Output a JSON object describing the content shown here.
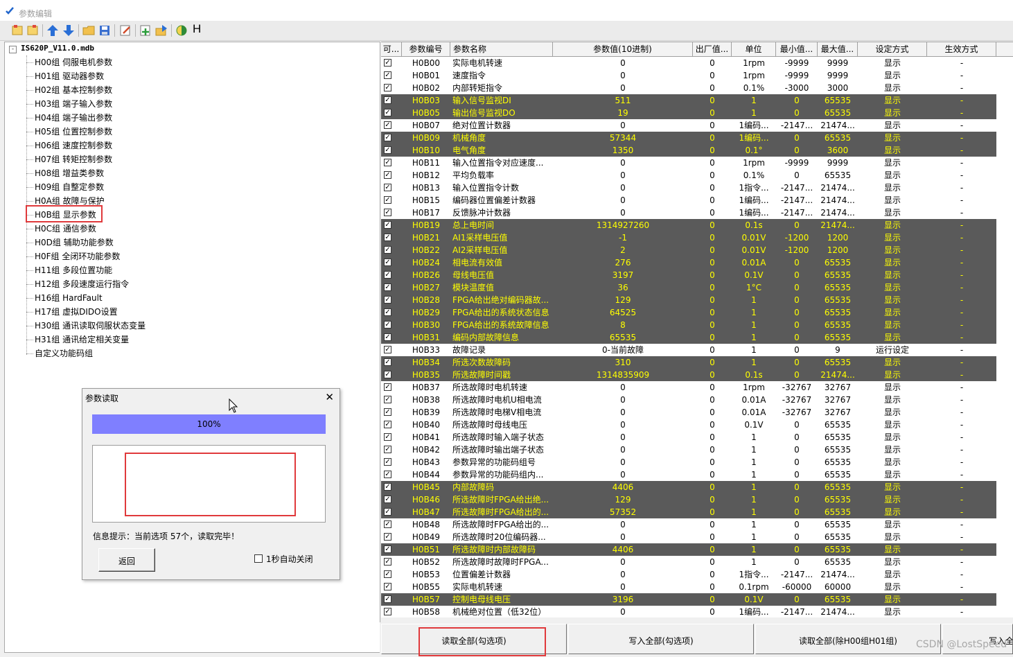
{
  "window": {
    "title": "参数编辑"
  },
  "toolbar": {
    "icons": [
      "new-icon",
      "new-folder-icon",
      "arrow-up-icon",
      "arrow-down-icon",
      "open-folder-icon",
      "save-icon",
      "edit-doc-icon",
      "add-icon",
      "import-icon",
      "contrast-icon"
    ],
    "h_label": "H"
  },
  "tree": {
    "root": "IS620P_V11.0.mdb",
    "expander": "-",
    "items": [
      "H00组 伺服电机参数",
      "H01组 驱动器参数",
      "H02组 基本控制参数",
      "H03组 端子输入参数",
      "H04组 端子输出参数",
      "H05组 位置控制参数",
      "H06组 速度控制参数",
      "H07组 转矩控制参数",
      "H08组 增益类参数",
      "H09组 自整定参数",
      "H0A组 故障与保护",
      "H0B组 显示参数",
      "H0C组 通信参数",
      "H0D组 辅助功能参数",
      "H0F组 全闭环功能参数",
      "H11组 多段位置功能",
      "H12组 多段速度运行指令",
      "H16组 HardFault",
      "H17组 虚拟DIDO设置",
      "H30组 通讯读取伺服状态变量",
      "H31组 通讯给定相关变量",
      "自定义功能码组"
    ]
  },
  "dialog": {
    "title": "参数读取",
    "close": "✕",
    "progress_percent": 100,
    "progress_label": "100%",
    "message_text": "",
    "info": "信息提示：当前选项 57个，读取完毕！",
    "back_button": "返回",
    "auto_close_label": "1秒自动关闭",
    "auto_close_checked": false
  },
  "table": {
    "columns": [
      "可...",
      "参数编号",
      "参数名称",
      "参数值(10进制)",
      "出厂值...",
      "单位",
      "最小值...",
      "最大值...",
      "设定方式",
      "生效方式"
    ],
    "rows": [
      {
        "id": "H0B00",
        "name": "实际电机转速",
        "value": "0",
        "factory": "0",
        "unit": "1rpm",
        "min": "-9999",
        "max": "9999",
        "mode": "显示",
        "effect": "-",
        "hl": false
      },
      {
        "id": "H0B01",
        "name": "速度指令",
        "value": "0",
        "factory": "0",
        "unit": "1rpm",
        "min": "-9999",
        "max": "9999",
        "mode": "显示",
        "effect": "-",
        "hl": false
      },
      {
        "id": "H0B02",
        "name": "内部转矩指令",
        "value": "0",
        "factory": "0",
        "unit": "0.1%",
        "min": "-3000",
        "max": "3000",
        "mode": "显示",
        "effect": "-",
        "hl": false
      },
      {
        "id": "H0B03",
        "name": "输入信号监视DI",
        "value": "511",
        "factory": "0",
        "unit": "1",
        "min": "0",
        "max": "65535",
        "mode": "显示",
        "effect": "-",
        "hl": true
      },
      {
        "id": "H0B05",
        "name": "输出信号监视DO",
        "value": "19",
        "factory": "0",
        "unit": "1",
        "min": "0",
        "max": "65535",
        "mode": "显示",
        "effect": "-",
        "hl": true
      },
      {
        "id": "H0B07",
        "name": "绝对位置计数器",
        "value": "0",
        "factory": "0",
        "unit": "1编码...",
        "min": "-2147...",
        "max": "21474...",
        "mode": "显示",
        "effect": "-",
        "hl": false
      },
      {
        "id": "H0B09",
        "name": "机械角度",
        "value": "57344",
        "factory": "0",
        "unit": "1编码...",
        "min": "0",
        "max": "65535",
        "mode": "显示",
        "effect": "-",
        "hl": true
      },
      {
        "id": "H0B10",
        "name": "电气角度",
        "value": "1350",
        "factory": "0",
        "unit": "0.1°",
        "min": "0",
        "max": "3600",
        "mode": "显示",
        "effect": "-",
        "hl": true
      },
      {
        "id": "H0B11",
        "name": "输入位置指令对应速度...",
        "value": "0",
        "factory": "0",
        "unit": "1rpm",
        "min": "-9999",
        "max": "9999",
        "mode": "显示",
        "effect": "-",
        "hl": false
      },
      {
        "id": "H0B12",
        "name": "平均负载率",
        "value": "0",
        "factory": "0",
        "unit": "0.1%",
        "min": "0",
        "max": "65535",
        "mode": "显示",
        "effect": "-",
        "hl": false
      },
      {
        "id": "H0B13",
        "name": "输入位置指令计数",
        "value": "0",
        "factory": "0",
        "unit": "1指令...",
        "min": "-2147...",
        "max": "21474...",
        "mode": "显示",
        "effect": "-",
        "hl": false
      },
      {
        "id": "H0B15",
        "name": "编码器位置偏差计数器",
        "value": "0",
        "factory": "0",
        "unit": "1编码...",
        "min": "-2147...",
        "max": "21474...",
        "mode": "显示",
        "effect": "-",
        "hl": false
      },
      {
        "id": "H0B17",
        "name": "反馈脉冲计数器",
        "value": "0",
        "factory": "0",
        "unit": "1编码...",
        "min": "-2147...",
        "max": "21474...",
        "mode": "显示",
        "effect": "-",
        "hl": false
      },
      {
        "id": "H0B19",
        "name": "总上电时间",
        "value": "1314927260",
        "factory": "0",
        "unit": "0.1s",
        "min": "0",
        "max": "21474...",
        "mode": "显示",
        "effect": "-",
        "hl": true
      },
      {
        "id": "H0B21",
        "name": "AI1采样电压值",
        "value": "-1",
        "factory": "0",
        "unit": "0.01V",
        "min": "-1200",
        "max": "1200",
        "mode": "显示",
        "effect": "-",
        "hl": true
      },
      {
        "id": "H0B22",
        "name": "AI2采样电压值",
        "value": "2",
        "factory": "0",
        "unit": "0.01V",
        "min": "-1200",
        "max": "1200",
        "mode": "显示",
        "effect": "-",
        "hl": true
      },
      {
        "id": "H0B24",
        "name": "相电流有效值",
        "value": "276",
        "factory": "0",
        "unit": "0.01A",
        "min": "0",
        "max": "65535",
        "mode": "显示",
        "effect": "-",
        "hl": true
      },
      {
        "id": "H0B26",
        "name": "母线电压值",
        "value": "3197",
        "factory": "0",
        "unit": "0.1V",
        "min": "0",
        "max": "65535",
        "mode": "显示",
        "effect": "-",
        "hl": true
      },
      {
        "id": "H0B27",
        "name": "模块温度值",
        "value": "36",
        "factory": "0",
        "unit": "1°C",
        "min": "0",
        "max": "65535",
        "mode": "显示",
        "effect": "-",
        "hl": true
      },
      {
        "id": "H0B28",
        "name": "FPGA给出绝对编码器故...",
        "value": "129",
        "factory": "0",
        "unit": "1",
        "min": "0",
        "max": "65535",
        "mode": "显示",
        "effect": "-",
        "hl": true
      },
      {
        "id": "H0B29",
        "name": "FPGA给出的系统状态信息",
        "value": "64525",
        "factory": "0",
        "unit": "1",
        "min": "0",
        "max": "65535",
        "mode": "显示",
        "effect": "-",
        "hl": true
      },
      {
        "id": "H0B30",
        "name": "FPGA给出的系统故障信息",
        "value": "8",
        "factory": "0",
        "unit": "1",
        "min": "0",
        "max": "65535",
        "mode": "显示",
        "effect": "-",
        "hl": true
      },
      {
        "id": "H0B31",
        "name": "编码内部故障信息",
        "value": "65535",
        "factory": "0",
        "unit": "1",
        "min": "0",
        "max": "65535",
        "mode": "显示",
        "effect": "-",
        "hl": true
      },
      {
        "id": "H0B33",
        "name": "故障记录",
        "value": "0-当前故障",
        "factory": "0",
        "unit": "1",
        "min": "0",
        "max": "9",
        "mode": "运行设定",
        "effect": "-",
        "hl": false
      },
      {
        "id": "H0B34",
        "name": "所选次数故障码",
        "value": "310",
        "factory": "0",
        "unit": "1",
        "min": "0",
        "max": "65535",
        "mode": "显示",
        "effect": "-",
        "hl": true
      },
      {
        "id": "H0B35",
        "name": "所选故障时间戳",
        "value": "1314835909",
        "factory": "0",
        "unit": "0.1s",
        "min": "0",
        "max": "21474...",
        "mode": "显示",
        "effect": "-",
        "hl": true
      },
      {
        "id": "H0B37",
        "name": "所选故障时电机转速",
        "value": "0",
        "factory": "0",
        "unit": "1rpm",
        "min": "-32767",
        "max": "32767",
        "mode": "显示",
        "effect": "-",
        "hl": false
      },
      {
        "id": "H0B38",
        "name": "所选故障时电机U相电流",
        "value": "0",
        "factory": "0",
        "unit": "0.01A",
        "min": "-32767",
        "max": "32767",
        "mode": "显示",
        "effect": "-",
        "hl": false
      },
      {
        "id": "H0B39",
        "name": "所选故障时电梯V相电流",
        "value": "0",
        "factory": "0",
        "unit": "0.01A",
        "min": "-32767",
        "max": "32767",
        "mode": "显示",
        "effect": "-",
        "hl": false
      },
      {
        "id": "H0B40",
        "name": "所选故障时母线电压",
        "value": "0",
        "factory": "0",
        "unit": "0.1V",
        "min": "0",
        "max": "65535",
        "mode": "显示",
        "effect": "-",
        "hl": false
      },
      {
        "id": "H0B41",
        "name": "所选故障时输入端子状态",
        "value": "0",
        "factory": "0",
        "unit": "1",
        "min": "0",
        "max": "65535",
        "mode": "显示",
        "effect": "-",
        "hl": false
      },
      {
        "id": "H0B42",
        "name": "所选故障时输出端子状态",
        "value": "0",
        "factory": "0",
        "unit": "1",
        "min": "0",
        "max": "65535",
        "mode": "显示",
        "effect": "-",
        "hl": false
      },
      {
        "id": "H0B43",
        "name": "参数异常的功能码组号",
        "value": "0",
        "factory": "0",
        "unit": "1",
        "min": "0",
        "max": "65535",
        "mode": "显示",
        "effect": "-",
        "hl": false
      },
      {
        "id": "H0B44",
        "name": "参数异常的功能码组内...",
        "value": "0",
        "factory": "0",
        "unit": "1",
        "min": "0",
        "max": "65535",
        "mode": "显示",
        "effect": "-",
        "hl": false
      },
      {
        "id": "H0B45",
        "name": "内部故障码",
        "value": "4406",
        "factory": "0",
        "unit": "1",
        "min": "0",
        "max": "65535",
        "mode": "显示",
        "effect": "-",
        "hl": true
      },
      {
        "id": "H0B46",
        "name": "所选故障时FPGA给出绝...",
        "value": "129",
        "factory": "0",
        "unit": "1",
        "min": "0",
        "max": "65535",
        "mode": "显示",
        "effect": "-",
        "hl": true
      },
      {
        "id": "H0B47",
        "name": "所选故障时FPGA给出的...",
        "value": "57352",
        "factory": "0",
        "unit": "1",
        "min": "0",
        "max": "65535",
        "mode": "显示",
        "effect": "-",
        "hl": true
      },
      {
        "id": "H0B48",
        "name": "所选故障时FPGA给出的...",
        "value": "0",
        "factory": "0",
        "unit": "1",
        "min": "0",
        "max": "65535",
        "mode": "显示",
        "effect": "-",
        "hl": false
      },
      {
        "id": "H0B49",
        "name": "所选故障时20位编码器...",
        "value": "0",
        "factory": "0",
        "unit": "1",
        "min": "0",
        "max": "65535",
        "mode": "显示",
        "effect": "-",
        "hl": false
      },
      {
        "id": "H0B51",
        "name": "所选故障时内部故障码",
        "value": "4406",
        "factory": "0",
        "unit": "1",
        "min": "0",
        "max": "65535",
        "mode": "显示",
        "effect": "-",
        "hl": true
      },
      {
        "id": "H0B52",
        "name": "所选故障时故障时FPGA...",
        "value": "0",
        "factory": "0",
        "unit": "1",
        "min": "0",
        "max": "65535",
        "mode": "显示",
        "effect": "-",
        "hl": false
      },
      {
        "id": "H0B53",
        "name": "位置偏差计数器",
        "value": "0",
        "factory": "0",
        "unit": "1指令...",
        "min": "-2147...",
        "max": "21474...",
        "mode": "显示",
        "effect": "-",
        "hl": false
      },
      {
        "id": "H0B55",
        "name": "实际电机转速",
        "value": "0",
        "factory": "0",
        "unit": "0.1rpm",
        "min": "-60000",
        "max": "60000",
        "mode": "显示",
        "effect": "-",
        "hl": false
      },
      {
        "id": "H0B57",
        "name": "控制电母线电压",
        "value": "3196",
        "factory": "0",
        "unit": "0.1V",
        "min": "0",
        "max": "65535",
        "mode": "显示",
        "effect": "-",
        "hl": true
      },
      {
        "id": "H0B58",
        "name": "机械绝对位置（低32位）",
        "value": "0",
        "factory": "0",
        "unit": "1编码...",
        "min": "-2147...",
        "max": "21474...",
        "mode": "显示",
        "effect": "-",
        "hl": false
      }
    ]
  },
  "bottom_buttons": [
    "读取全部(勾选项)",
    "写入全部(勾选项)",
    "读取全部(除H00组H01组)",
    "写入全"
  ],
  "watermark": "CSDN @LostSpeed",
  "colors": {
    "highlight_row_bg": "#5a5a5a",
    "highlight_row_text": "#ffff00",
    "progress": "#7f7fff",
    "annotation_red": "#e0393b"
  }
}
